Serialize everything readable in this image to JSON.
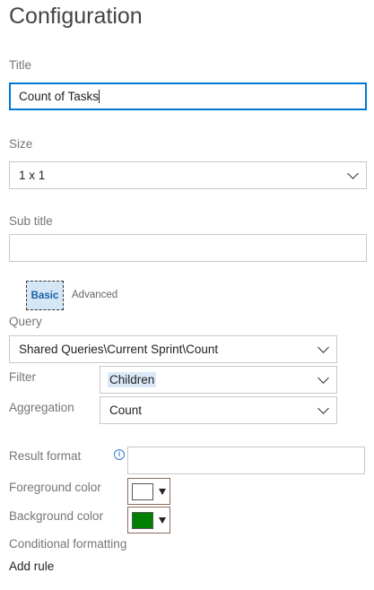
{
  "header": {
    "title": "Configuration"
  },
  "fields": {
    "title_label": "Title",
    "title_value": "Count of Tasks",
    "size_label": "Size",
    "size_value": "1 x 1",
    "subtitle_label": "Sub title",
    "subtitle_value": ""
  },
  "tabs": {
    "basic": "Basic",
    "advanced": "Advanced"
  },
  "query": {
    "label": "Query",
    "value": "Shared Queries\\Current Sprint\\Count",
    "filter_label": "Filter",
    "filter_value": "Children",
    "aggregation_label": "Aggregation",
    "aggregation_value": "Count"
  },
  "result": {
    "format_label": "Result format",
    "format_value": "",
    "info_icon": "info-icon",
    "foreground_label": "Foreground color",
    "foreground_color": "#ffffff",
    "background_label": "Background color",
    "background_color": "#008000"
  },
  "conditional": {
    "label": "Conditional formatting",
    "add_rule": "Add rule"
  },
  "colors": {
    "accent": "#0078d4",
    "basic_tab_bg": "#d5e6f4"
  }
}
